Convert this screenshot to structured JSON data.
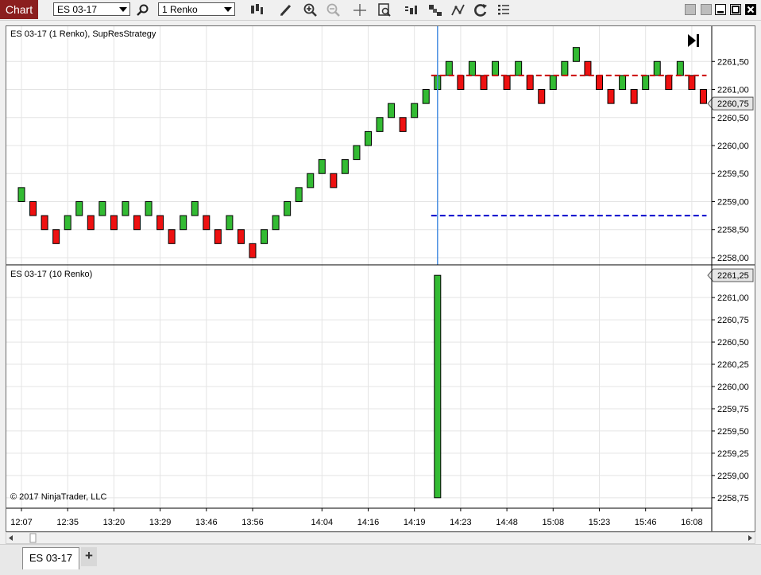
{
  "toolbar": {
    "chart_label": "Chart",
    "instrument": "ES 03-17",
    "period": "1 Renko",
    "icons": [
      "search-icon",
      "bar-type-icon",
      "draw-tool-icon",
      "zoom-in-icon",
      "zoom-out-icon",
      "crosshair-icon",
      "data-box-icon",
      "strategies-icon",
      "indicators-icon",
      "drawing-objects-icon",
      "refresh-icon",
      "properties-icon"
    ]
  },
  "window": {
    "controls": [
      "tile-left",
      "tile-right",
      "minimize",
      "maximize",
      "close"
    ]
  },
  "chart": {
    "top_panel_label": "ES 03-17 (1 Renko), SupResStrategy",
    "bottom_panel_label": "ES 03-17 (10 Renko)",
    "copyright": "© 2017 NinjaTrader, LLC",
    "top_current_price": "2260,75",
    "bottom_current_price": "2261,25"
  },
  "chart_data": [
    {
      "type": "candlestick",
      "title": "ES 03-17 (1 Renko), SupResStrategy",
      "y_ticks": [
        "2258,00",
        "2258,50",
        "2259,00",
        "2259,50",
        "2260,00",
        "2260,50",
        "2261,00",
        "2261,50"
      ],
      "ylim": [
        2257.9,
        2262.1
      ],
      "x_ticks": [
        "12:07",
        "12:35",
        "13:20",
        "13:29",
        "13:46",
        "13:56",
        "14:04",
        "14:16",
        "14:19",
        "14:23",
        "14:48",
        "15:08",
        "15:23",
        "15:46",
        "16:08"
      ],
      "bricks": [
        {
          "bar": 0,
          "low": 2259.0,
          "high": 2259.25,
          "dir": "up"
        },
        {
          "bar": 1,
          "low": 2258.75,
          "high": 2259.0,
          "dir": "down"
        },
        {
          "bar": 2,
          "low": 2258.5,
          "high": 2258.75,
          "dir": "down"
        },
        {
          "bar": 3,
          "low": 2258.25,
          "high": 2258.5,
          "dir": "down"
        },
        {
          "bar": 4,
          "low": 2258.5,
          "high": 2258.75,
          "dir": "up"
        },
        {
          "bar": 5,
          "low": 2258.75,
          "high": 2259.0,
          "dir": "up"
        },
        {
          "bar": 6,
          "low": 2258.5,
          "high": 2258.75,
          "dir": "down"
        },
        {
          "bar": 7,
          "low": 2258.75,
          "high": 2259.0,
          "dir": "up"
        },
        {
          "bar": 8,
          "low": 2258.5,
          "high": 2258.75,
          "dir": "down"
        },
        {
          "bar": 9,
          "low": 2258.75,
          "high": 2259.0,
          "dir": "up"
        },
        {
          "bar": 10,
          "low": 2258.5,
          "high": 2258.75,
          "dir": "down"
        },
        {
          "bar": 11,
          "low": 2258.75,
          "high": 2259.0,
          "dir": "up"
        },
        {
          "bar": 12,
          "low": 2258.5,
          "high": 2258.75,
          "dir": "down"
        },
        {
          "bar": 13,
          "low": 2258.25,
          "high": 2258.5,
          "dir": "down"
        },
        {
          "bar": 14,
          "low": 2258.5,
          "high": 2258.75,
          "dir": "up"
        },
        {
          "bar": 15,
          "low": 2258.75,
          "high": 2259.0,
          "dir": "up"
        },
        {
          "bar": 16,
          "low": 2258.5,
          "high": 2258.75,
          "dir": "down"
        },
        {
          "bar": 17,
          "low": 2258.25,
          "high": 2258.5,
          "dir": "down"
        },
        {
          "bar": 18,
          "low": 2258.5,
          "high": 2258.75,
          "dir": "up"
        },
        {
          "bar": 19,
          "low": 2258.25,
          "high": 2258.5,
          "dir": "down"
        },
        {
          "bar": 20,
          "low": 2258.0,
          "high": 2258.25,
          "dir": "down"
        },
        {
          "bar": 21,
          "low": 2258.25,
          "high": 2258.5,
          "dir": "up"
        },
        {
          "bar": 22,
          "low": 2258.5,
          "high": 2258.75,
          "dir": "up"
        },
        {
          "bar": 23,
          "low": 2258.75,
          "high": 2259.0,
          "dir": "up"
        },
        {
          "bar": 24,
          "low": 2259.0,
          "high": 2259.25,
          "dir": "up"
        },
        {
          "bar": 25,
          "low": 2259.25,
          "high": 2259.5,
          "dir": "up"
        },
        {
          "bar": 26,
          "low": 2259.5,
          "high": 2259.75,
          "dir": "up"
        },
        {
          "bar": 27,
          "low": 2259.25,
          "high": 2259.5,
          "dir": "down"
        },
        {
          "bar": 28,
          "low": 2259.5,
          "high": 2259.75,
          "dir": "up"
        },
        {
          "bar": 29,
          "low": 2259.75,
          "high": 2260.0,
          "dir": "up"
        },
        {
          "bar": 30,
          "low": 2260.0,
          "high": 2260.25,
          "dir": "up"
        },
        {
          "bar": 31,
          "low": 2260.25,
          "high": 2260.5,
          "dir": "up"
        },
        {
          "bar": 32,
          "low": 2260.5,
          "high": 2260.75,
          "dir": "up"
        },
        {
          "bar": 33,
          "low": 2260.25,
          "high": 2260.5,
          "dir": "down"
        },
        {
          "bar": 34,
          "low": 2260.5,
          "high": 2260.75,
          "dir": "up"
        },
        {
          "bar": 35,
          "low": 2260.75,
          "high": 2261.0,
          "dir": "up"
        },
        {
          "bar": 36,
          "low": 2261.0,
          "high": 2261.25,
          "dir": "up"
        },
        {
          "bar": 37,
          "low": 2261.25,
          "high": 2261.5,
          "dir": "up"
        },
        {
          "bar": 38,
          "low": 2261.0,
          "high": 2261.25,
          "dir": "down"
        },
        {
          "bar": 39,
          "low": 2261.25,
          "high": 2261.5,
          "dir": "up"
        },
        {
          "bar": 40,
          "low": 2261.0,
          "high": 2261.25,
          "dir": "down"
        },
        {
          "bar": 41,
          "low": 2261.25,
          "high": 2261.5,
          "dir": "up"
        },
        {
          "bar": 42,
          "low": 2261.0,
          "high": 2261.25,
          "dir": "down"
        },
        {
          "bar": 43,
          "low": 2261.25,
          "high": 2261.5,
          "dir": "up"
        },
        {
          "bar": 44,
          "low": 2261.0,
          "high": 2261.25,
          "dir": "down"
        },
        {
          "bar": 45,
          "low": 2260.75,
          "high": 2261.0,
          "dir": "down"
        },
        {
          "bar": 46,
          "low": 2261.0,
          "high": 2261.25,
          "dir": "up"
        },
        {
          "bar": 47,
          "low": 2261.25,
          "high": 2261.5,
          "dir": "up"
        },
        {
          "bar": 48,
          "low": 2261.5,
          "high": 2261.75,
          "dir": "up"
        },
        {
          "bar": 49,
          "low": 2261.25,
          "high": 2261.5,
          "dir": "down"
        },
        {
          "bar": 50,
          "low": 2261.0,
          "high": 2261.25,
          "dir": "down"
        },
        {
          "bar": 51,
          "low": 2260.75,
          "high": 2261.0,
          "dir": "down"
        },
        {
          "bar": 52,
          "low": 2261.0,
          "high": 2261.25,
          "dir": "up"
        },
        {
          "bar": 53,
          "low": 2260.75,
          "high": 2261.0,
          "dir": "down"
        },
        {
          "bar": 54,
          "low": 2261.0,
          "high": 2261.25,
          "dir": "up"
        },
        {
          "bar": 55,
          "low": 2261.25,
          "high": 2261.5,
          "dir": "up"
        },
        {
          "bar": 56,
          "low": 2261.0,
          "high": 2261.25,
          "dir": "down"
        },
        {
          "bar": 57,
          "low": 2261.25,
          "high": 2261.5,
          "dir": "up"
        },
        {
          "bar": 58,
          "low": 2261.0,
          "high": 2261.25,
          "dir": "down"
        },
        {
          "bar": 59,
          "low": 2260.75,
          "high": 2261.0,
          "dir": "down"
        }
      ],
      "lines": [
        {
          "kind": "resistance",
          "style": "dashed",
          "color": "#cc0000",
          "price": 2261.25,
          "from_bar": 36,
          "to_bar": 59
        },
        {
          "kind": "support",
          "style": "dashed",
          "color": "#0000cc",
          "price": 2258.75,
          "from_bar": 36,
          "to_bar": 59
        }
      ],
      "cursor_bar": 36
    },
    {
      "type": "candlestick",
      "title": "ES 03-17 (10 Renko)",
      "y_ticks": [
        "2258,75",
        "2259,00",
        "2259,25",
        "2259,50",
        "2259,75",
        "2260,00",
        "2260,25",
        "2260,50",
        "2260,75",
        "2261,00"
      ],
      "ylim": [
        2258.65,
        2261.35
      ],
      "bricks": [
        {
          "bar": 36,
          "low": 2258.75,
          "high": 2261.25,
          "dir": "up"
        }
      ]
    }
  ],
  "colors": {
    "up_brick": "#33bb33",
    "down_brick": "#ee1111",
    "brick_outline": "#000000",
    "grid": "#e4e4e4",
    "cursor": "#4a90e2",
    "chart_badge": "#8b1e1e"
  },
  "tabs": {
    "active": "ES 03-17",
    "add_label": "+"
  }
}
